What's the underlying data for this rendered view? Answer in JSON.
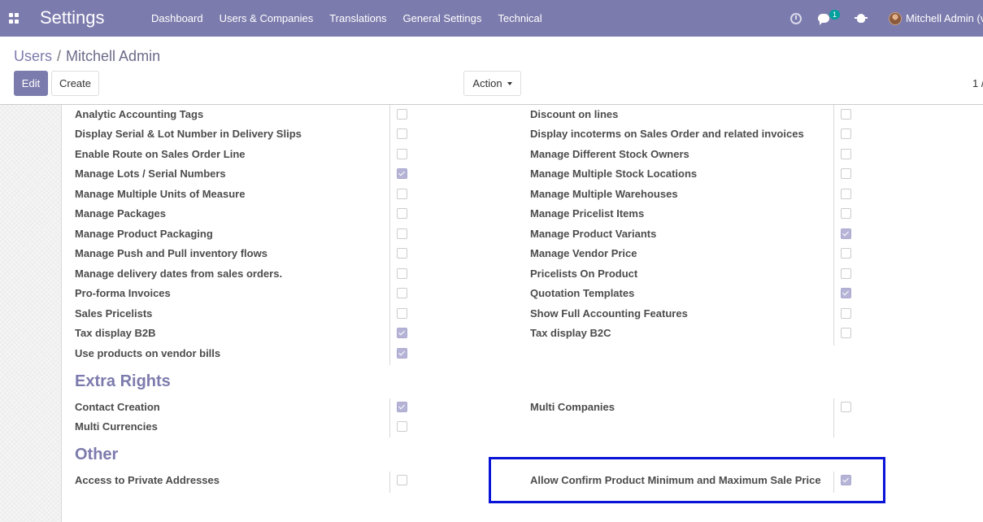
{
  "navbar": {
    "brand": "Settings",
    "menu": [
      "Dashboard",
      "Users & Companies",
      "Translations",
      "General Settings",
      "Technical"
    ],
    "chat_badge": "1",
    "user_name": "Mitchell Admin (v"
  },
  "breadcrumb": {
    "parent": "Users",
    "separator": "/",
    "current": "Mitchell Admin"
  },
  "buttons": {
    "edit": "Edit",
    "create": "Create",
    "action": "Action"
  },
  "pager": "1 /",
  "rights": {
    "left": [
      {
        "label": "Analytic Accounting Tags",
        "checked": false
      },
      {
        "label": "Display Serial & Lot Number in Delivery Slips",
        "checked": false
      },
      {
        "label": "Enable Route on Sales Order Line",
        "checked": false
      },
      {
        "label": "Manage Lots / Serial Numbers",
        "checked": true
      },
      {
        "label": "Manage Multiple Units of Measure",
        "checked": false
      },
      {
        "label": "Manage Packages",
        "checked": false
      },
      {
        "label": "Manage Product Packaging",
        "checked": false
      },
      {
        "label": "Manage Push and Pull inventory flows",
        "checked": false
      },
      {
        "label": "Manage delivery dates from sales orders.",
        "checked": false
      },
      {
        "label": "Pro-forma Invoices",
        "checked": false
      },
      {
        "label": "Sales Pricelists",
        "checked": false
      },
      {
        "label": "Tax display B2B",
        "checked": true
      },
      {
        "label": "Use products on vendor bills",
        "checked": true
      }
    ],
    "right": [
      {
        "label": "Discount on lines",
        "checked": false
      },
      {
        "label": "Display incoterms on Sales Order and related invoices",
        "checked": false
      },
      {
        "label": "Manage Different Stock Owners",
        "checked": false
      },
      {
        "label": "Manage Multiple Stock Locations",
        "checked": false
      },
      {
        "label": "Manage Multiple Warehouses",
        "checked": false
      },
      {
        "label": "Manage Pricelist Items",
        "checked": false
      },
      {
        "label": "Manage Product Variants",
        "checked": true
      },
      {
        "label": "Manage Vendor Price",
        "checked": false
      },
      {
        "label": "Pricelists On Product",
        "checked": false
      },
      {
        "label": "Quotation Templates",
        "checked": true
      },
      {
        "label": "Show Full Accounting Features",
        "checked": false
      },
      {
        "label": "Tax display B2C",
        "checked": false
      }
    ]
  },
  "extra_rights": {
    "title": "Extra Rights",
    "left": [
      {
        "label": "Contact Creation",
        "checked": true
      },
      {
        "label": "Multi Currencies",
        "checked": false
      }
    ],
    "right": [
      {
        "label": "Multi Companies",
        "checked": false
      }
    ]
  },
  "other": {
    "title": "Other",
    "left": [
      {
        "label": "Access to Private Addresses",
        "checked": false
      }
    ],
    "right": [
      {
        "label": "Allow Confirm Product Minimum and Maximum Sale Price",
        "checked": true
      }
    ]
  },
  "colors": {
    "brand": "#7c7bad",
    "highlight_border": "#0a14d6",
    "checkbox_checked": "#b6b4d6"
  }
}
